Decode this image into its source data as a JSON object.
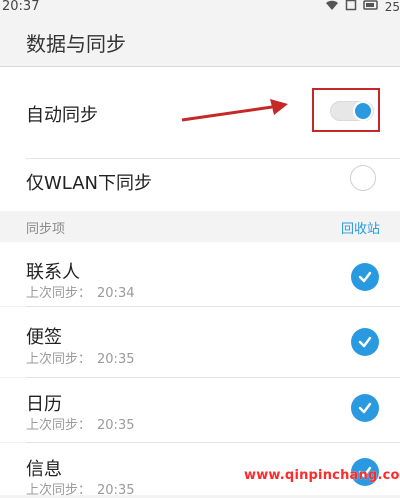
{
  "status_bar": {
    "time": "20:37",
    "battery_label": "25",
    "icons": [
      "wifi-icon",
      "sim-icon",
      "battery-icon"
    ]
  },
  "header": {
    "title": "数据与同步"
  },
  "settings": {
    "auto_sync": {
      "label": "自动同步",
      "enabled": true
    },
    "wlan_only": {
      "label": "仅WLAN下同步",
      "enabled": false
    }
  },
  "section": {
    "title": "同步项",
    "recycle_link": "回收站"
  },
  "sync_items": [
    {
      "name": "联系人",
      "last_sync_label": "上次同步：",
      "last_sync_time": "20:34",
      "checked": true
    },
    {
      "name": "便签",
      "last_sync_label": "上次同步：",
      "last_sync_time": "20:35",
      "checked": true
    },
    {
      "name": "日历",
      "last_sync_label": "上次同步：",
      "last_sync_time": "20:35",
      "checked": true
    },
    {
      "name": "信息",
      "last_sync_label": "上次同步：",
      "last_sync_time": "20:35",
      "checked": true
    }
  ],
  "watermark": "www.qinpinchang.com",
  "colors": {
    "accent": "#2a9ae0",
    "annotation": "#c62828"
  }
}
